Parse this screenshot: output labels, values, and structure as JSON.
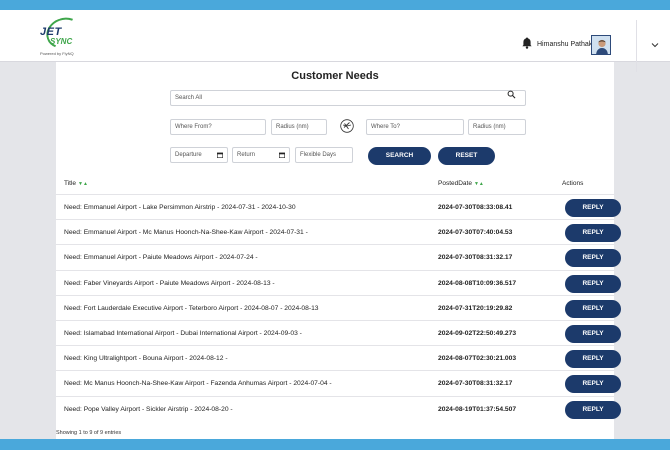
{
  "header": {
    "logo_line1": "JET",
    "logo_line2": "SYNC",
    "logo_powered": "Powered by FlyNQ",
    "username": "Himanshu Pathak"
  },
  "page": {
    "title": "Customer Needs"
  },
  "filters": {
    "search_placeholder": "Search All",
    "where_from_placeholder": "Where From?",
    "radius_from_placeholder": "Radius (nm)",
    "where_to_placeholder": "Where To?",
    "radius_to_placeholder": "Radius (nm)",
    "departure_label": "Departure",
    "return_label": "Return",
    "flexible_days_placeholder": "Flexible Days",
    "search_button": "SEARCH",
    "reset_button": "RESET"
  },
  "table": {
    "columns": {
      "title": "Title",
      "posted_date": "PostedDate",
      "actions": "Actions"
    },
    "sort_indicator": "▼▲",
    "reply_label": "REPLY",
    "rows": [
      {
        "title": "Need: Emmanuel Airport - Lake Persimmon Airstrip - 2024-07-31 - 2024-10-30",
        "posted": "2024-07-30T08:33:08.41"
      },
      {
        "title": "Need: Emmanuel Airport - Mc Manus Hoonch-Na-Shee-Kaw Airport - 2024-07-31 -",
        "posted": "2024-07-30T07:40:04.53"
      },
      {
        "title": "Need: Emmanuel Airport - Paiute Meadows Airport - 2024-07-24 -",
        "posted": "2024-07-30T08:31:32.17"
      },
      {
        "title": "Need: Faber Vineyards Airport - Paiute Meadows Airport - 2024-08-13 -",
        "posted": "2024-08-08T10:09:36.517"
      },
      {
        "title": "Need: Fort Lauderdale Executive Airport - Teterboro Airport - 2024-08-07 - 2024-08-13",
        "posted": "2024-07-31T20:19:29.82"
      },
      {
        "title": "Need: Islamabad International Airport - Dubai International Airport - 2024-09-03 -",
        "posted": "2024-09-02T22:50:49.273"
      },
      {
        "title": "Need: King Ultralightport - Bouna Airport - 2024-08-12 -",
        "posted": "2024-08-07T02:30:21.003"
      },
      {
        "title": "Need: Mc Manus Hoonch-Na-Shee-Kaw Airport - Fazenda Anhumas Airport - 2024-07-04 -",
        "posted": "2024-07-30T08:31:32.17"
      },
      {
        "title": "Need: Pope Valley Airport - Sickler Airstrip - 2024-08-20 -",
        "posted": "2024-08-19T01:37:54.507"
      }
    ],
    "footer": "Showing 1 to 9 of 9 entries"
  },
  "colors": {
    "primary": "#1c3a6b",
    "accent": "#4aa8db",
    "green": "#3fa64b"
  }
}
